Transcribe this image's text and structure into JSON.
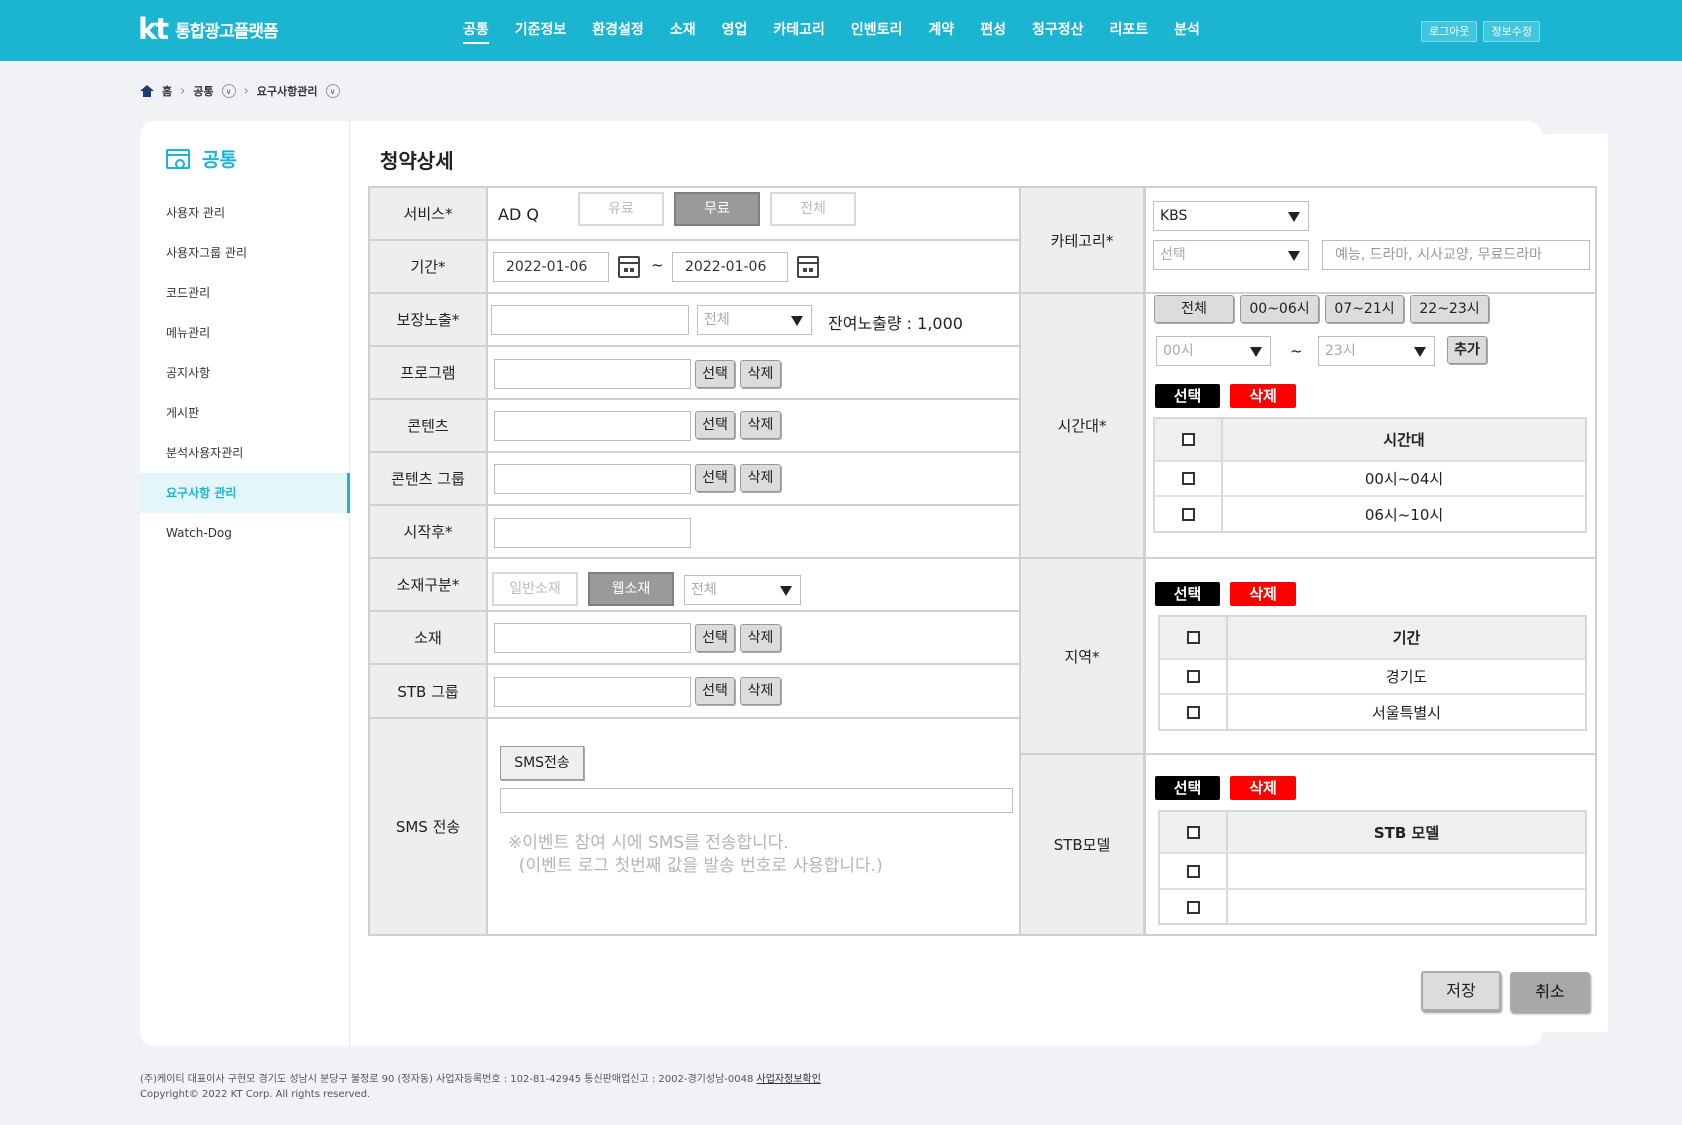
{
  "header": {
    "logo_mark": "kt",
    "logo_text": "통합광고플랫폼",
    "nav": [
      "공통",
      "기준정보",
      "환경설정",
      "소재",
      "영업",
      "카테고리",
      "인벤토리",
      "계약",
      "편성",
      "청구정산",
      "리포트",
      "분석"
    ],
    "active_nav": "공통",
    "logout": "로그아웃",
    "edit_info": "정보수정"
  },
  "breadcrumb": {
    "home": "홈",
    "level1": "공통",
    "level2": "요구사항관리"
  },
  "sidebar": {
    "title": "공통",
    "items": [
      "사용자 관리",
      "사용자그룹 관리",
      "코드관리",
      "메뉴관리",
      "공지사항",
      "게시판",
      "분석사용자관리",
      "요구사항 관리",
      "Watch-Dog"
    ],
    "active": "요구사항 관리"
  },
  "page": {
    "title": "청약상세"
  },
  "form": {
    "service": {
      "label": "서비스*",
      "value": "AD Q",
      "options": [
        "유료",
        "무료",
        "전체"
      ],
      "selected": "무료"
    },
    "period": {
      "label": "기간*",
      "start": "2022-01-06",
      "end": "2022-01-06",
      "tilde": "~"
    },
    "guaranteed": {
      "label": "보장노출*",
      "select": "전체",
      "remaining": "잔여노출량 : 1,000"
    },
    "program": {
      "label": "프로그램"
    },
    "contents": {
      "label": "콘텐츠"
    },
    "contents_group": {
      "label": "콘텐츠 그룹"
    },
    "start_after": {
      "label": "시작후*"
    },
    "material_type": {
      "label": "소재구분*",
      "options": [
        "일반소재",
        "웹소재"
      ],
      "selected": "웹소재",
      "select": "전체"
    },
    "material": {
      "label": "소재"
    },
    "stb_group": {
      "label": "STB 그룹"
    },
    "sms": {
      "label": "SMS 전송",
      "button": "SMS전송",
      "note": "※이벤트 참여 시에 SMS를 전송합니다.\n  (이벤트 로그 첫번째 값을 발송 번호로 사용합니다.)"
    },
    "select_btn": "선택",
    "delete_btn": "삭제"
  },
  "right": {
    "category": {
      "label": "카테고리*",
      "select1": "KBS",
      "select2": "선택",
      "tags_placeholder": "예능, 드라마, 시사교양, 무료드라마"
    },
    "timeslot": {
      "label": "시간대*",
      "presets": [
        "전체",
        "00~06시",
        "07~21시",
        "22~23시"
      ],
      "from": "00시",
      "to": "23시",
      "tilde": "~",
      "add": "추가",
      "header": "시간대",
      "rows": [
        "00시~04시",
        "06시~10시"
      ]
    },
    "region": {
      "label": "지역*",
      "header": "기간",
      "rows": [
        "경기도",
        "서울특별시"
      ]
    },
    "stb_model": {
      "label": "STB모델",
      "header": "STB 모델",
      "rows": [
        "",
        ""
      ]
    },
    "select_btn": "선택",
    "delete_btn": "삭제"
  },
  "actions": {
    "save": "저장",
    "cancel": "취소"
  },
  "footer": {
    "line1": "(주)케이티 대표이사 구현모 경기도 성남시 분당구 불정로 90 (정자동) 사업자등록번호 : 102-81-42945 통신판매업신고 : 2002-경기성남-0048 ",
    "link": "사업자정보확인",
    "line2": "Copyright© 2022 KT Corp. All rights reserved."
  },
  "colors": {
    "brand": "#1bb5d2",
    "active_bg": "#e5f6fa",
    "danger": "#ff0000"
  }
}
